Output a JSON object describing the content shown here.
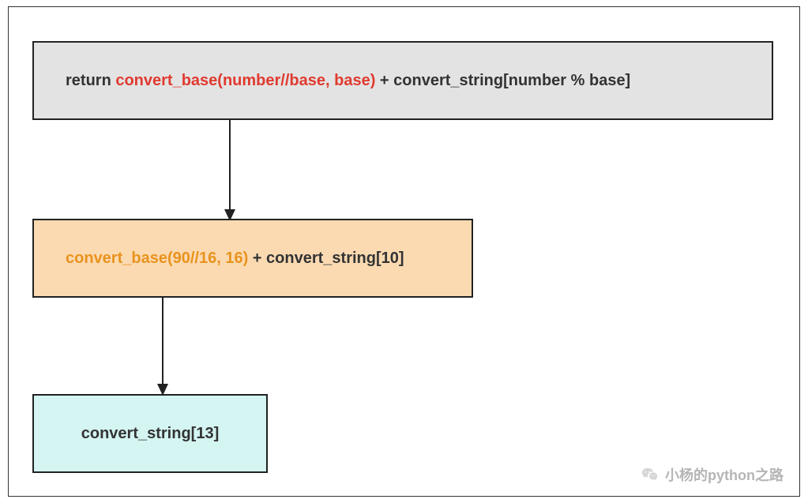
{
  "box1": {
    "prefix": "return ",
    "highlight": "convert_base(number//base, base)",
    "suffix": " + convert_string[number % base]"
  },
  "box2": {
    "highlight": "convert_base(90//16, 16)",
    "suffix": " + convert_string[10]"
  },
  "box3": {
    "text": "convert_string[13]"
  },
  "watermark": "小杨的python之路",
  "colors": {
    "highlight1": "#e03a2f",
    "highlight2": "#e8931e",
    "box1_bg": "#e3e3e3",
    "box2_bg": "#fbdab2",
    "box3_bg": "#d4f5f2"
  }
}
